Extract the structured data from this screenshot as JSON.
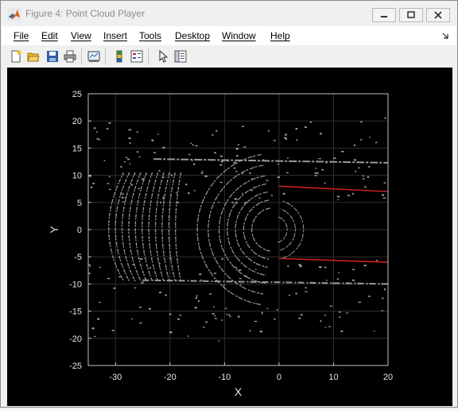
{
  "window": {
    "title": "Figure 4: Point Cloud Player"
  },
  "menu": [
    "File",
    "Edit",
    "View",
    "Insert",
    "Tools",
    "Desktop",
    "Window",
    "Help"
  ],
  "toolbar": {
    "icons": [
      "new-figure-icon",
      "open-file-icon",
      "save-icon",
      "print-icon",
      "link-plot-icon",
      "insert-colorbar-icon",
      "insert-legend-icon",
      "edit-plot-pointer-icon",
      "property-inspector-icon"
    ]
  },
  "colors": {
    "background": "#000000",
    "points": "#9a9a9a",
    "track_lines": "#c81e1e",
    "axes": "#bfbfbf"
  },
  "chart_data": {
    "type": "scatter",
    "xlabel": "X",
    "ylabel": "Y",
    "xlim": [
      -35,
      20
    ],
    "ylim": [
      -25,
      25
    ],
    "xticks": [
      -30,
      -20,
      -10,
      0,
      10,
      20
    ],
    "yticks": [
      25,
      20,
      15,
      10,
      5,
      0,
      -5,
      -10,
      -15,
      -20,
      -25
    ],
    "grid": true,
    "series": [
      {
        "color": "#c81e1e",
        "points": [
          [
            0,
            8
          ],
          [
            20,
            7
          ]
        ]
      },
      {
        "color": "#c81e1e",
        "points": [
          [
            0,
            -5.3
          ],
          [
            20,
            -6
          ]
        ]
      }
    ]
  }
}
